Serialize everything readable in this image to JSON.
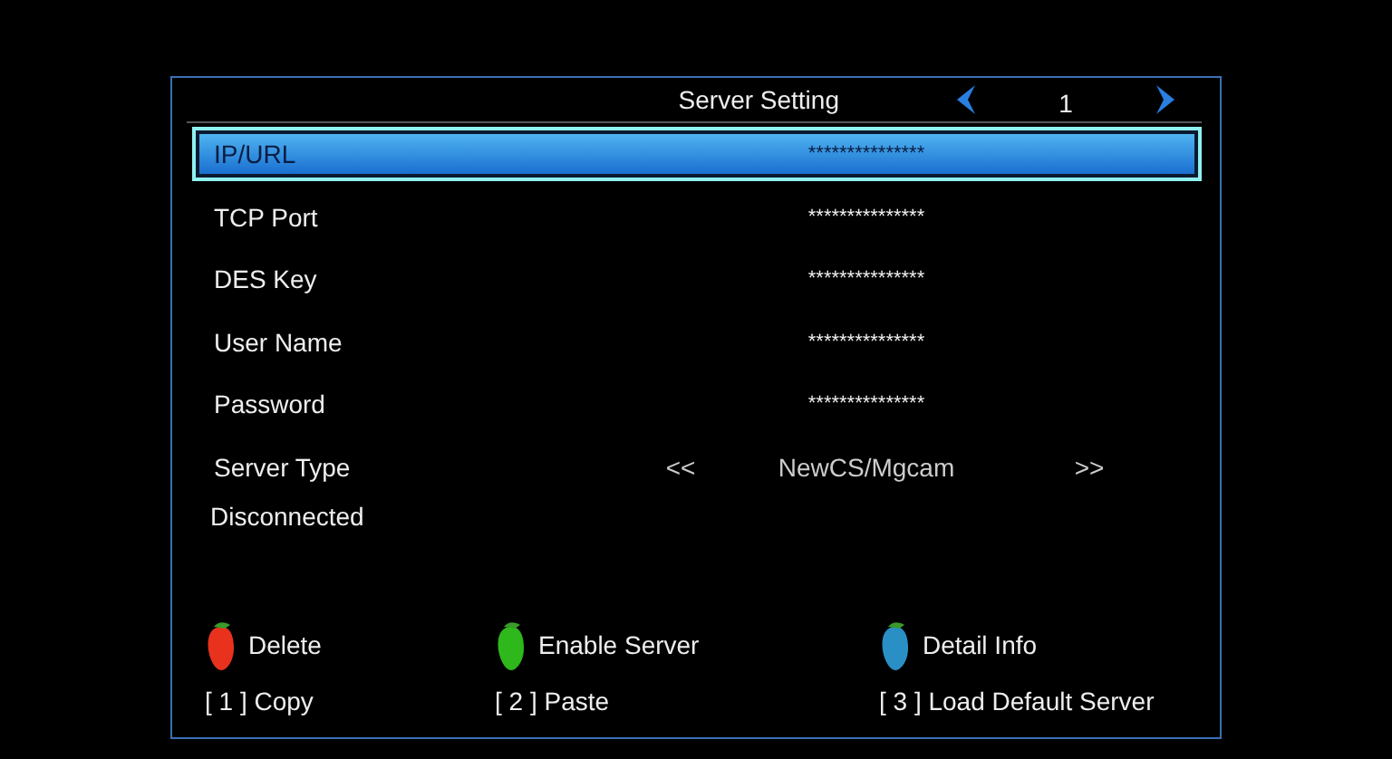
{
  "header": {
    "title": "Server Setting",
    "page": "1"
  },
  "rows": [
    {
      "kind": "field",
      "label": "IP/URL",
      "value": "***************",
      "selected": true
    },
    {
      "kind": "field",
      "label": "TCP Port",
      "value": "***************",
      "selected": false
    },
    {
      "kind": "field",
      "label": "DES Key",
      "value": "***************",
      "selected": false
    },
    {
      "kind": "field",
      "label": "User Name",
      "value": "***************",
      "selected": false
    },
    {
      "kind": "field",
      "label": "Password",
      "value": "***************",
      "selected": false
    },
    {
      "kind": "choice",
      "label": "Server Type",
      "prev": "<<",
      "value": "NewCS/Mgcam",
      "next": ">>",
      "selected": false
    }
  ],
  "status": "Disconnected",
  "color_keys": [
    {
      "label": "Delete",
      "color": "#e8321e"
    },
    {
      "label": "Enable Server",
      "color": "#2eb81c"
    },
    {
      "label": "Detail Info",
      "color": "#2a8fc4"
    }
  ],
  "number_keys": [
    "[ 1 ] Copy",
    "[ 2 ] Paste",
    "[ 3 ] Load Default Server"
  ]
}
